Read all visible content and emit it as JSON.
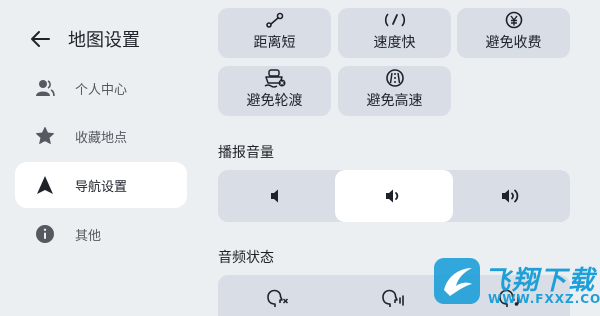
{
  "header": {
    "title": "地图设置"
  },
  "sidebar": {
    "items": [
      {
        "label": "个人中心",
        "icon": "person-icon",
        "active": false
      },
      {
        "label": "收藏地点",
        "icon": "star-icon",
        "active": false
      },
      {
        "label": "导航设置",
        "icon": "navigation-arrow-icon",
        "active": true
      },
      {
        "label": "其他",
        "icon": "info-icon",
        "active": false
      }
    ]
  },
  "route_preferences": {
    "options": [
      {
        "label": "距离短",
        "icon": "short-distance-icon"
      },
      {
        "label": "速度快",
        "icon": "fast-speed-icon"
      },
      {
        "label": "避免收费",
        "icon": "avoid-toll-icon"
      },
      {
        "label": "避免轮渡",
        "icon": "avoid-ferry-icon"
      },
      {
        "label": "避免高速",
        "icon": "avoid-highway-icon"
      }
    ]
  },
  "broadcast_volume": {
    "title": "播报音量",
    "options": [
      "volume-low-icon",
      "volume-medium-icon",
      "volume-high-icon"
    ],
    "selected_index": 1
  },
  "audio_status": {
    "title": "音频状态",
    "options": [
      "voice-mute-icon",
      "voice-low-icon",
      "voice-music-icon"
    ]
  },
  "watermark": {
    "text": "飞翔下载",
    "url": "WWW.FXXZ.COM"
  },
  "colors": {
    "background": "#eceff2",
    "button": "#d8dde6",
    "active": "#ffffff",
    "brand": "#1d9fd8"
  }
}
